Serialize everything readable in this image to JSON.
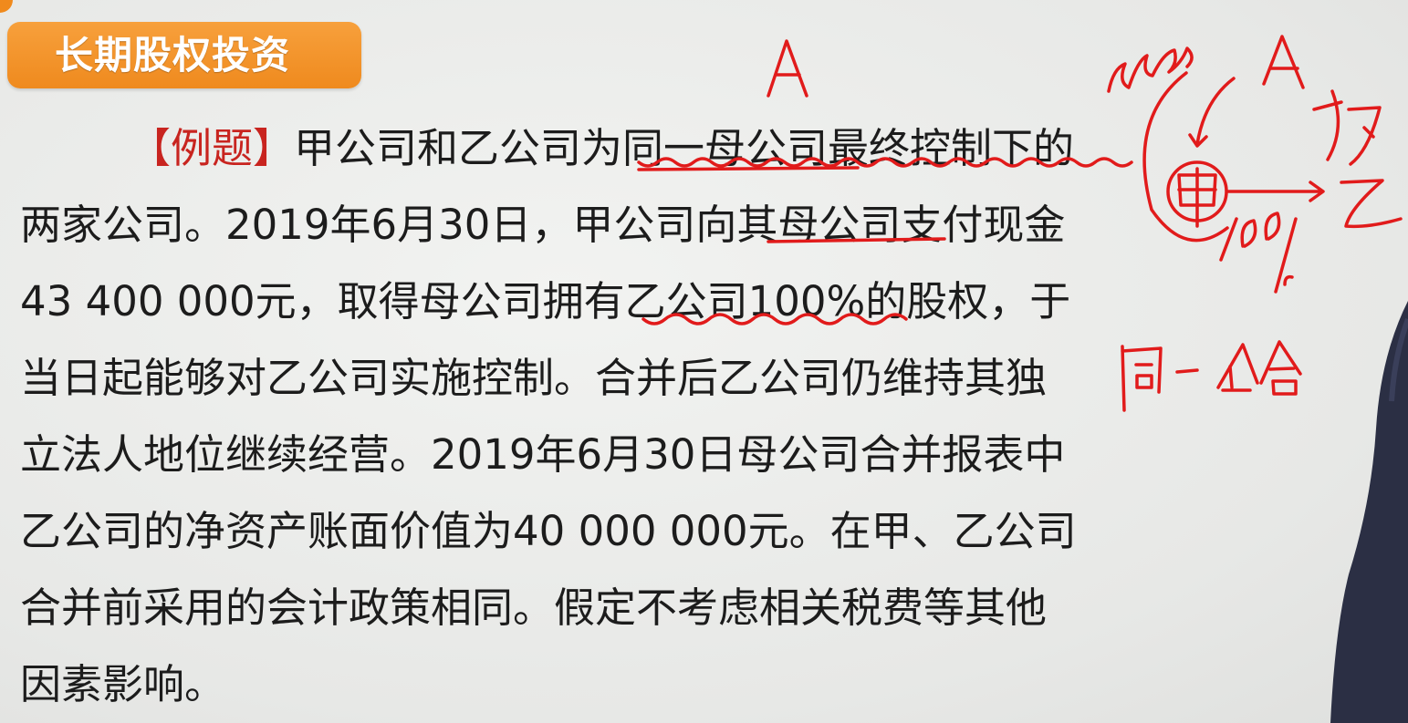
{
  "slide": {
    "title": "长期股权投资",
    "example_tag": "【例题】",
    "paragraph_lines": [
      "甲公司和乙公司为同一母公司最终控制下的",
      "两家公司。2019年6月30日，甲公司向其母公司支付现金",
      "43 400 000元，取得母公司拥有乙公司100%的股权，于",
      "当日起能够对乙公司实施控制。合并后乙公司仍维持其独",
      "立法人地位继续经营。2019年6月30日母公司合并报表中",
      "乙公司的净资产账面价值为40 000 000元。在甲、乙公司",
      "合并前采用的会计政策相同。假定不考虑相关税费等其他",
      "因素影响。"
    ]
  },
  "colors": {
    "title_bg": "#ef8a1e",
    "title_text": "#ffffff",
    "tag": "#c8241f",
    "ink": "#e11b1b",
    "body_text": "#1c1c1c"
  }
}
